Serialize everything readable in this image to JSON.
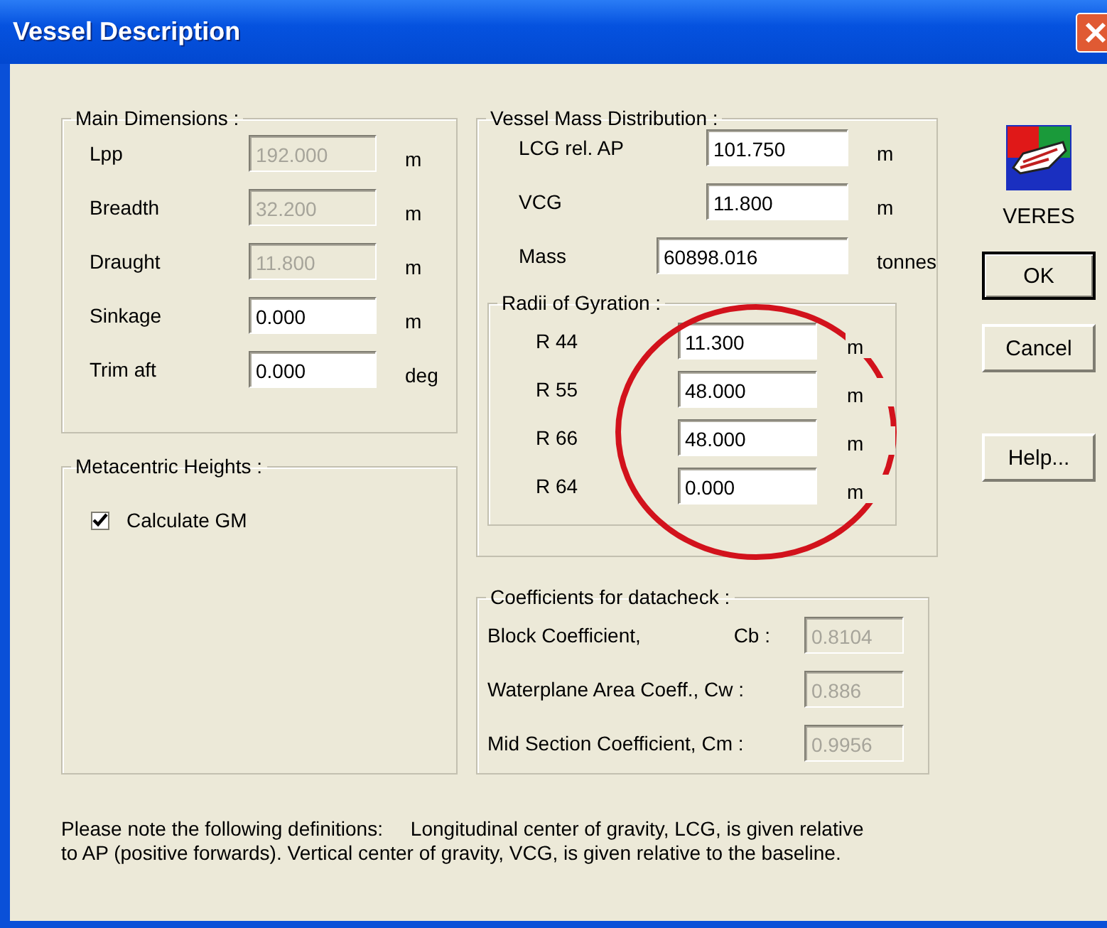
{
  "window": {
    "title": "Vessel Description"
  },
  "main_dimensions": {
    "title": "Main Dimensions :",
    "rows": [
      {
        "label": "Lpp",
        "value": "192.000",
        "unit": "m",
        "disabled": true
      },
      {
        "label": "Breadth",
        "value": "32.200",
        "unit": "m",
        "disabled": true
      },
      {
        "label": "Draught",
        "value": "11.800",
        "unit": "m",
        "disabled": true
      },
      {
        "label": "Sinkage",
        "value": "0.000",
        "unit": "m",
        "disabled": false
      },
      {
        "label": "Trim aft",
        "value": "0.000",
        "unit": "deg",
        "disabled": false
      }
    ]
  },
  "metacentric_heights": {
    "title": "Metacentric Heights :",
    "checkbox": {
      "label": "Calculate GM",
      "checked": true
    }
  },
  "mass_distribution": {
    "title": "Vessel Mass Distribution :",
    "rows": [
      {
        "label": "LCG rel. AP",
        "value": "101.750",
        "unit": "m",
        "wide": false
      },
      {
        "label": "VCG",
        "value": "11.800",
        "unit": "m",
        "wide": false
      },
      {
        "label": "Mass",
        "value": "60898.016",
        "unit": "tonnes",
        "wide": true
      }
    ],
    "radii": {
      "title": "Radii of Gyration :",
      "rows": [
        {
          "label": "R 44",
          "value": "11.300",
          "unit": "m"
        },
        {
          "label": "R 55",
          "value": "48.000",
          "unit": "m"
        },
        {
          "label": "R 66",
          "value": "48.000",
          "unit": "m"
        },
        {
          "label": "R 64",
          "value": "0.000",
          "unit": "m"
        }
      ]
    }
  },
  "coefficients": {
    "title": "Coefficients for datacheck :",
    "rows": [
      {
        "label": "Block Coefficient,",
        "symbol": "Cb :",
        "value": "0.8104",
        "disabled": true
      },
      {
        "label": "Waterplane Area Coeff., Cw :",
        "value": "0.886",
        "disabled": true
      },
      {
        "label": "Mid Section Coefficient, Cm :",
        "value": "0.9956",
        "disabled": true
      }
    ]
  },
  "logo": {
    "label": "VERES"
  },
  "buttons": [
    {
      "label": "OK",
      "default": true
    },
    {
      "label": "Cancel",
      "default": false
    },
    {
      "label": "Help...",
      "default": false
    }
  ],
  "note_lines": [
    "Please note the following definitions:     Longitudinal center of gravity, LCG, is given relative",
    "to AP (positive forwards). Vertical center of gravity, VCG, is given relative to the baseline."
  ]
}
